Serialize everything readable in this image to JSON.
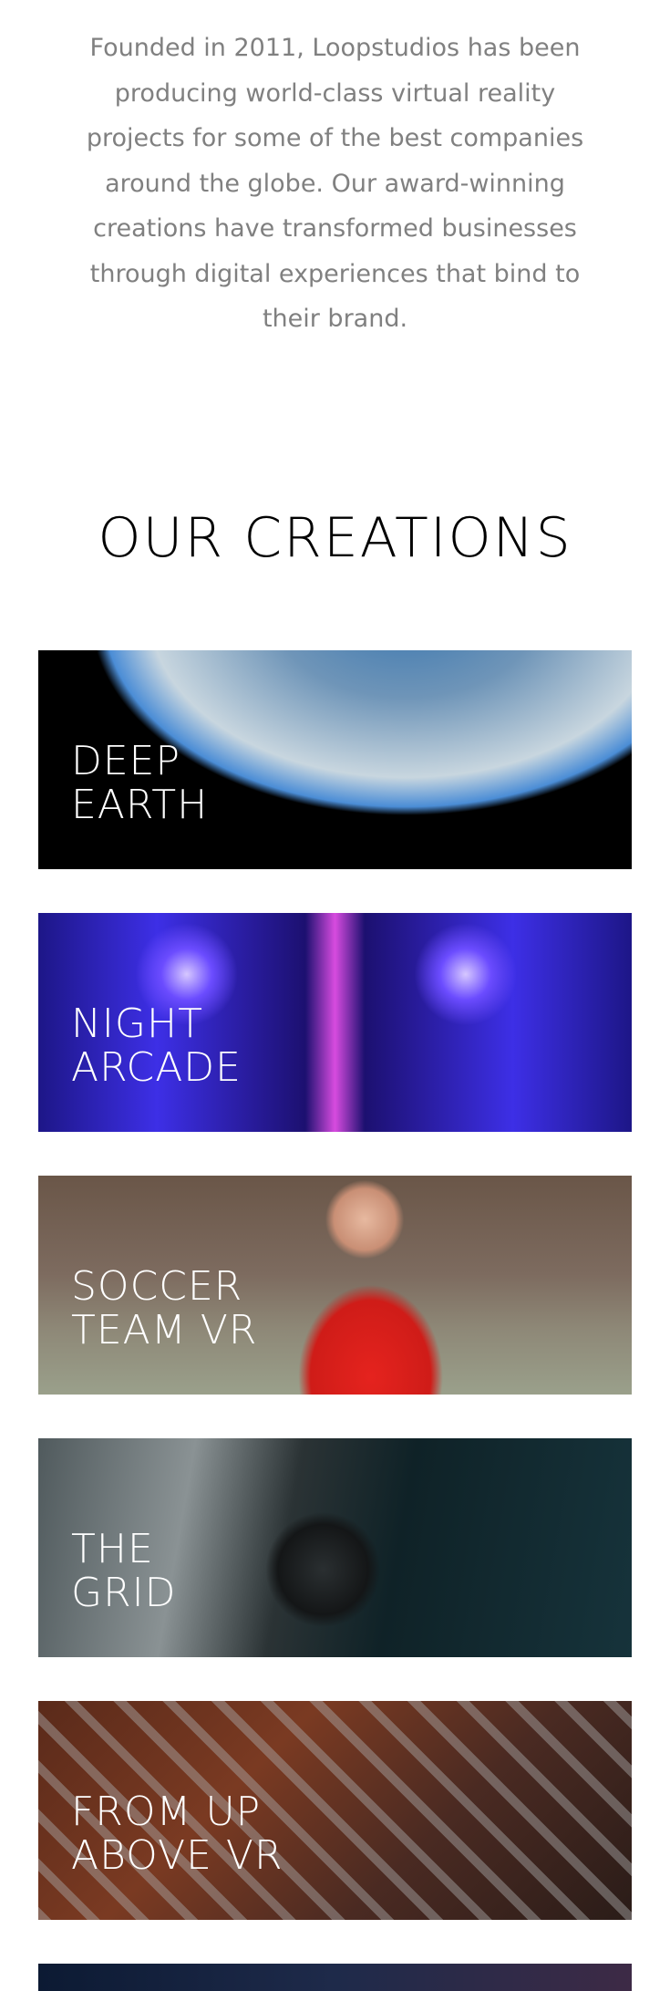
{
  "intro": {
    "text": "Founded in 2011, Loopstudios has been producing world-class virtual reality projects for some of the best companies around the globe. Our award-winning creations have transformed businesses through digital experiences that bind to their brand."
  },
  "creations": {
    "heading": "OUR CREATIONS",
    "items": [
      {
        "line1": "DEEP",
        "line2": "EARTH"
      },
      {
        "line1": "NIGHT",
        "line2": "ARCADE"
      },
      {
        "line1": "SOCCER",
        "line2": "TEAM VR"
      },
      {
        "line1": "THE",
        "line2": "GRID"
      },
      {
        "line1": "FROM UP",
        "line2": "ABOVE VR"
      }
    ]
  }
}
